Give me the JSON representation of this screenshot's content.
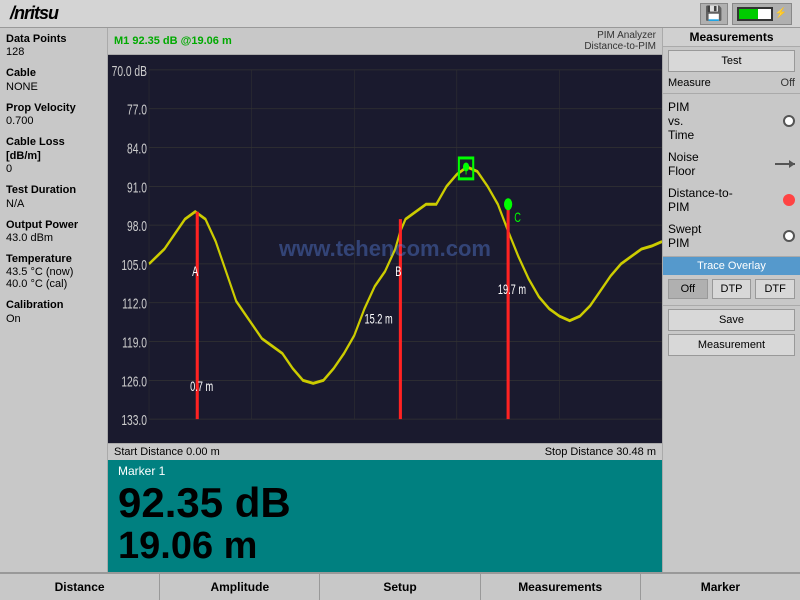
{
  "header": {
    "logo": "/nritsu",
    "save_icon": "💾"
  },
  "left_panel": {
    "data_points_label": "Data Points",
    "data_points_value": "128",
    "cable_label": "Cable",
    "cable_value": "NONE",
    "prop_velocity_label": "Prop Velocity",
    "prop_velocity_value": "0.700",
    "cable_loss_label": "Cable Loss [dB/m]",
    "cable_loss_value": "0",
    "test_duration_label": "Test Duration",
    "test_duration_value": "N/A",
    "output_power_label": "Output Power",
    "output_power_value": "43.0 dBm",
    "temperature_label": "Temperature",
    "temperature_now": "43.5 °C (now)",
    "temperature_cal": "40.0 °C (cal)",
    "calibration_label": "Calibration",
    "calibration_value": "On"
  },
  "chart": {
    "y_axis": [
      "70.0 dB",
      "77.0",
      "84.0",
      "91.0",
      "98.0",
      "105.0",
      "112.0",
      "119.0",
      "126.0",
      "133.0"
    ],
    "marker_label": "M1 92.35 dB @19.06 m",
    "pim_analyzer": "PIM Analyzer",
    "distance_to_pim": "Distance-to-PIM",
    "watermark": "www.tehencom.com",
    "start_distance": "Start Distance 0.00 m",
    "stop_distance": "Stop Distance 30.48 m",
    "annotation_a": "A",
    "annotation_b": "B",
    "annotation_c": "C",
    "annotation_t": "T",
    "dist_07": "0.7 m",
    "dist_152": "15.2 m",
    "dist_197": "19.7 m"
  },
  "marker_display": {
    "title": "Marker 1",
    "db_value": "92.35 dB",
    "m_value": "19.06 m"
  },
  "right_panel": {
    "title": "Measurements",
    "test_label": "Test",
    "measure_label": "Measure",
    "measure_value": "Off",
    "pim_vs_time_label": "PIM\nvs.\nTime",
    "noise_floor_label": "Noise\nFloor",
    "distance_to_pim_label": "Distance-to-\nPIM",
    "swept_pim_label": "Swept\nPIM",
    "trace_overlay_label": "Trace Overlay",
    "trace_off": "Off",
    "trace_dtp": "DTP",
    "trace_dtf": "DTF",
    "save_label": "Save",
    "measurement_label": "Measurement"
  },
  "bottom_tabs": {
    "tab1": "Distance",
    "tab2": "Amplitude",
    "tab3": "Setup",
    "tab4": "Measurements",
    "tab5": "Marker"
  }
}
